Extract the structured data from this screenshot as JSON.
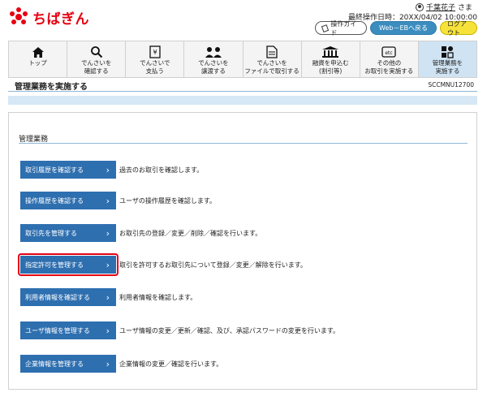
{
  "header": {
    "brand": "ちばぎん",
    "user_name": "千葉花子",
    "user_suffix": "さま",
    "last_operation": "最終操作日時：20XX/04/02 10:00:00",
    "guide_label": "操作ガイド",
    "web_eb_label": "Web－EBへ戻る",
    "logout_label": "ログアウト"
  },
  "nav": {
    "items": [
      {
        "label": "トップ",
        "icon": "home-icon"
      },
      {
        "label": "でんさいを\n確認する",
        "icon": "search-icon"
      },
      {
        "label": "でんさいで\n支払う",
        "icon": "payment-icon"
      },
      {
        "label": "でんさいを\n譲渡する",
        "icon": "transfer-icon"
      },
      {
        "label": "でんさいを\nファイルで取引する",
        "icon": "file-icon"
      },
      {
        "label": "融資を申込む\n(割引等)",
        "icon": "bank-icon"
      },
      {
        "label": "その他の\nお取引を実施する",
        "icon": "etc-icon"
      },
      {
        "label": "管理業務を\n実施する",
        "icon": "admin-icon"
      }
    ]
  },
  "page": {
    "title": "管理業務を実施する",
    "screen_id": "SCCMNU12700",
    "section_title": "管理業務"
  },
  "menu": [
    {
      "button": "取引履歴を確認する",
      "desc": "過去のお取引を確認します。"
    },
    {
      "button": "操作履歴を確認する",
      "desc": "ユーザの操作履歴を確認します。"
    },
    {
      "button": "取引先を管理する",
      "desc": "お取引先の登録／変更／削除／確認を行います。"
    },
    {
      "button": "指定許可を管理する",
      "desc": "取引を許可するお取引先について登録／変更／解除を行います。"
    },
    {
      "button": "利用者情報を確認する",
      "desc": "利用者情報を確認します。"
    },
    {
      "button": "ユーザ情報を管理する",
      "desc": "ユーザ情報の変更／更新／確認、及び、承認パスワードの変更を行います。"
    },
    {
      "button": "企業情報を管理する",
      "desc": "企業情報の変更／確認を行います。"
    }
  ],
  "colors": {
    "brand_red": "#e60012",
    "menu_blue": "#2e6fb0",
    "highlight_red": "#e60012"
  }
}
